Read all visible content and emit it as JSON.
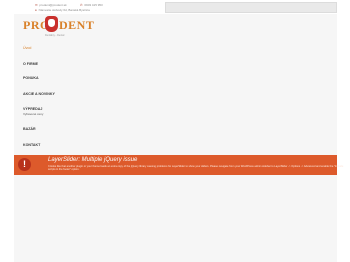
{
  "topbar": {
    "email": "prodent@prodent.sk",
    "phone": "0903 415 953",
    "address": "Námestie slobody 6d, Banská Bystrica"
  },
  "logo": {
    "brand_left": "PRO",
    "brand_right": "DENT",
    "slogan": "Dentálny  -  Dental"
  },
  "menu": {
    "items": [
      {
        "label": "Úvod"
      },
      {
        "label": "O FIRME"
      },
      {
        "label": "PONUKA"
      },
      {
        "label": "AKCIE A NOVINKY"
      },
      {
        "label": "VÝPREDAJ",
        "sub": "Vybavené ceny"
      },
      {
        "label": "BAZÁR"
      },
      {
        "label": "KONTAKT"
      }
    ]
  },
  "alert": {
    "icon_symbol": "!",
    "title": "LayerSlider: Multiple jQuery issue",
    "message": "It looks like that another plugin or your theme loads an extra copy of the jQuery library causing problems for LayerSlider to show your sliders. Please navigate from your WordPress admin sidebar to LayerSlider -> Options -> Advanced and enable the \"Include scripts in the footer\" option."
  },
  "colors": {
    "accent": "#d9822b",
    "alert": "#dd5a2b",
    "logo_red": "#c9302c"
  },
  "icons": [
    "mail-icon",
    "phone-icon",
    "location-icon",
    "tooth-logo-icon",
    "alert-icon"
  ]
}
